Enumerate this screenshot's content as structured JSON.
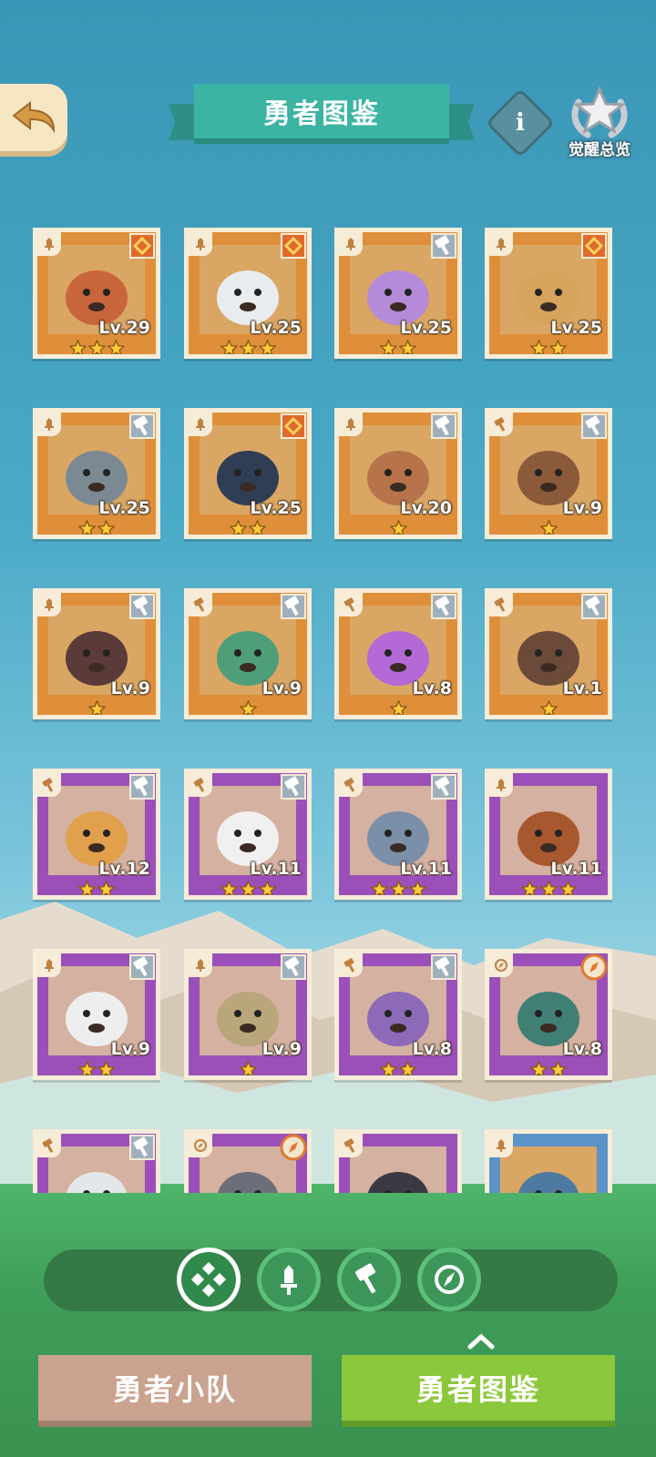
{
  "header": {
    "title": "勇者图鉴",
    "back_icon": "back-arrow-icon",
    "info_icon": "info-icon",
    "info_label": "i",
    "awaken_label": "觉醒总览",
    "awaken_icon": "star-laurel-icon"
  },
  "colors": {
    "rare_card": "#df8f3a",
    "epic_card": "#9b4fb8",
    "star": "#ffc93c",
    "title_board": "#3bb4a4",
    "squad_button": "#c9a38f",
    "book_button": "#8cc83c"
  },
  "heroes": [
    {
      "level": "Lv.29",
      "stars": 3,
      "rarity": "orange",
      "class_icon": "sword-icon",
      "badge": "rank-up-badge-icon"
    },
    {
      "level": "Lv.25",
      "stars": 3,
      "rarity": "orange",
      "class_icon": "sword-icon",
      "badge": "rank-up-badge-icon"
    },
    {
      "level": "Lv.25",
      "stars": 2,
      "rarity": "orange",
      "class_icon": "sword-icon",
      "badge": "hammer-badge-icon"
    },
    {
      "level": "Lv.25",
      "stars": 2,
      "rarity": "orange",
      "class_icon": "sword-icon",
      "badge": "rank-up-badge-icon"
    },
    {
      "level": "Lv.25",
      "stars": 2,
      "rarity": "orange",
      "class_icon": "sword-icon",
      "badge": "hammer-badge-icon"
    },
    {
      "level": "Lv.25",
      "stars": 2,
      "rarity": "orange",
      "class_icon": "sword-icon",
      "badge": "rank-up-badge-icon"
    },
    {
      "level": "Lv.20",
      "stars": 1,
      "rarity": "orange",
      "class_icon": "sword-icon",
      "badge": "hammer-badge-icon"
    },
    {
      "level": "Lv.9",
      "stars": 1,
      "rarity": "orange",
      "class_icon": "hammer-icon",
      "badge": "hammer-badge-icon"
    },
    {
      "level": "Lv.9",
      "stars": 1,
      "rarity": "orange",
      "class_icon": "sword-icon",
      "badge": "hammer-badge-icon"
    },
    {
      "level": "Lv.9",
      "stars": 1,
      "rarity": "orange",
      "class_icon": "hammer-icon",
      "badge": "hammer-badge-icon"
    },
    {
      "level": "Lv.8",
      "stars": 1,
      "rarity": "orange",
      "class_icon": "hammer-icon",
      "badge": "hammer-badge-icon"
    },
    {
      "level": "Lv.1",
      "stars": 1,
      "rarity": "orange",
      "class_icon": "hammer-icon",
      "badge": "hammer-badge-icon"
    },
    {
      "level": "Lv.12",
      "stars": 2,
      "rarity": "purple",
      "class_icon": "hammer-icon",
      "badge": "hammer-badge-icon"
    },
    {
      "level": "Lv.11",
      "stars": 3,
      "rarity": "purple",
      "class_icon": "hammer-icon",
      "badge": "hammer-badge-icon"
    },
    {
      "level": "Lv.11",
      "stars": 3,
      "rarity": "purple",
      "class_icon": "hammer-icon",
      "badge": "hammer-badge-icon"
    },
    {
      "level": "Lv.11",
      "stars": 3,
      "rarity": "purple",
      "class_icon": "sword-icon",
      "badge": ""
    },
    {
      "level": "Lv.9",
      "stars": 2,
      "rarity": "purple",
      "class_icon": "sword-icon",
      "badge": "hammer-badge-icon"
    },
    {
      "level": "Lv.9",
      "stars": 1,
      "rarity": "purple",
      "class_icon": "sword-icon",
      "badge": "hammer-badge-icon"
    },
    {
      "level": "Lv.8",
      "stars": 2,
      "rarity": "purple",
      "class_icon": "hammer-icon",
      "badge": "hammer-badge-icon"
    },
    {
      "level": "Lv.8",
      "stars": 2,
      "rarity": "purple",
      "class_icon": "compass-icon",
      "badge": "compass-badge-icon"
    },
    {
      "level": "",
      "stars": 0,
      "rarity": "purple",
      "class_icon": "hammer-icon",
      "badge": "hammer-badge-icon"
    },
    {
      "level": "",
      "stars": 0,
      "rarity": "purple",
      "class_icon": "compass-icon",
      "badge": "compass-badge-icon"
    },
    {
      "level": "",
      "stars": 0,
      "rarity": "purple",
      "class_icon": "hammer-icon",
      "badge": ""
    },
    {
      "level": "",
      "stars": 0,
      "rarity": "blue",
      "class_icon": "sword-icon",
      "badge": ""
    }
  ],
  "filters": [
    {
      "icon": "all-classes-icon",
      "active": true
    },
    {
      "icon": "sword-icon",
      "active": false
    },
    {
      "icon": "hammer-icon",
      "active": false
    },
    {
      "icon": "compass-icon",
      "active": false
    }
  ],
  "bottom_tabs": {
    "squad_label": "勇者小队",
    "book_label": "勇者图鉴",
    "expand_icon": "chevron-up-icon"
  }
}
